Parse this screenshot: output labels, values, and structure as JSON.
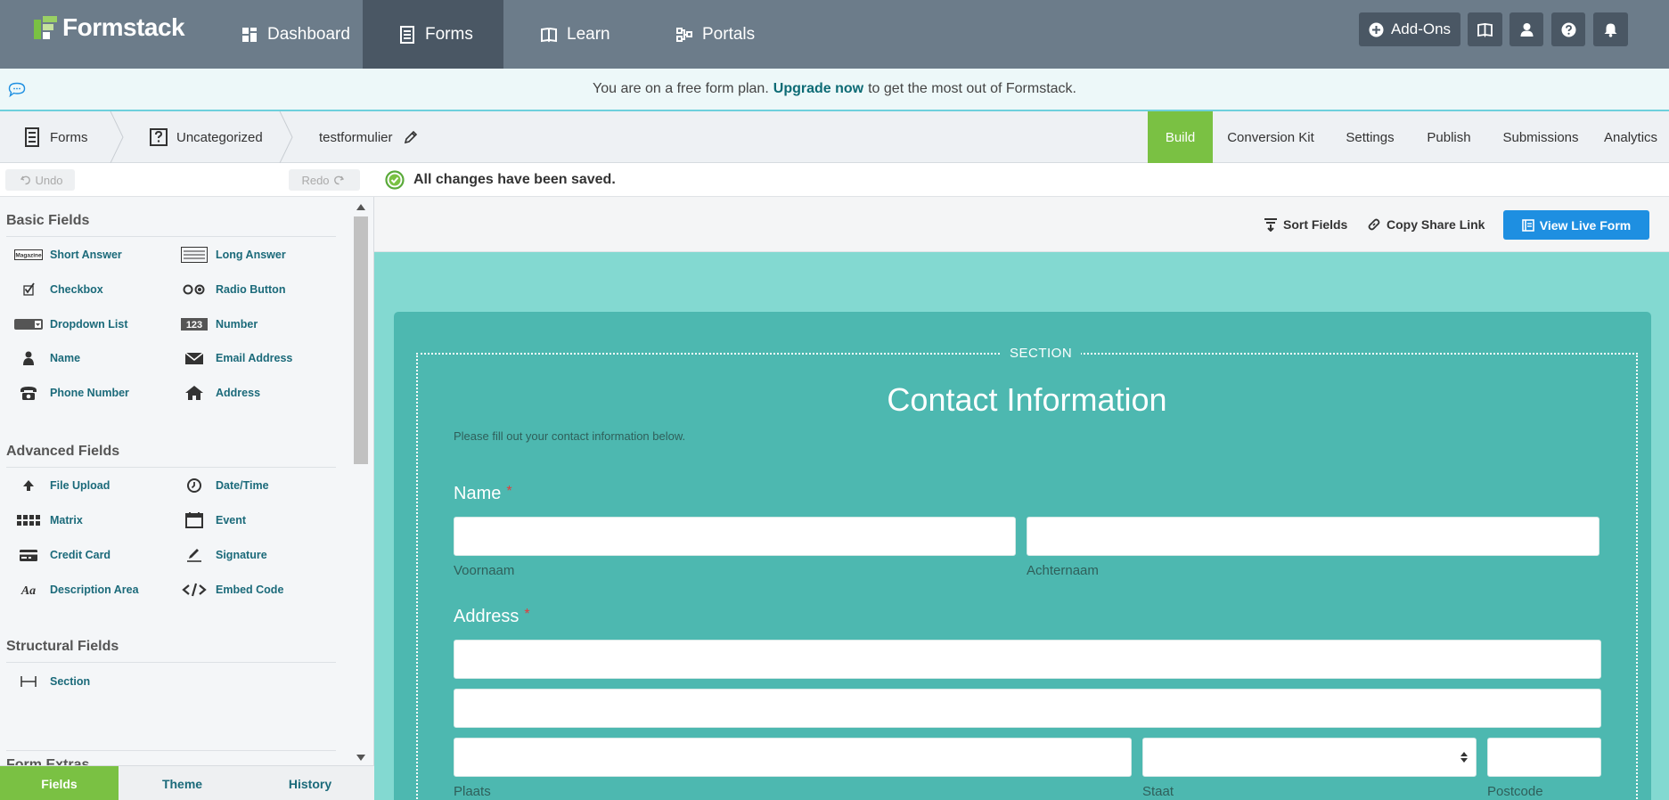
{
  "app": {
    "brand": "Formstack",
    "colors": {
      "nav_bg": "#6c7c8a",
      "nav_active": "#4a5764",
      "accent_green": "#7ac143",
      "primary_blue": "#1e8fe1",
      "form_bg": "#4db8b0",
      "canvas_bg": "#83d9d1"
    }
  },
  "topnav": {
    "items": [
      {
        "label": "Dashboard",
        "icon": "dashboard-icon"
      },
      {
        "label": "Forms",
        "icon": "forms-icon",
        "active": true
      },
      {
        "label": "Learn",
        "icon": "book-icon"
      },
      {
        "label": "Portals",
        "icon": "portals-icon"
      }
    ],
    "addons_label": "Add-Ons"
  },
  "notice": {
    "prefix": "You are on a free form plan.",
    "link": "Upgrade now",
    "suffix": "to get the most out of Formstack."
  },
  "breadcrumb": {
    "items": [
      "Forms",
      "Uncategorized",
      "testformulier"
    ]
  },
  "tabs": {
    "items": [
      "Build",
      "Conversion Kit",
      "Settings",
      "Publish",
      "Submissions",
      "Analytics"
    ],
    "active": "Build"
  },
  "history": {
    "undo": "Undo",
    "redo": "Redo"
  },
  "sidebar": {
    "sections": [
      {
        "title": "Basic Fields",
        "fields": [
          {
            "label": "Short Answer",
            "icon": "short-answer-icon"
          },
          {
            "label": "Long Answer",
            "icon": "long-answer-icon"
          },
          {
            "label": "Checkbox",
            "icon": "checkbox-icon"
          },
          {
            "label": "Radio Button",
            "icon": "radio-button-icon"
          },
          {
            "label": "Dropdown List",
            "icon": "dropdown-icon"
          },
          {
            "label": "Number",
            "icon": "number-icon"
          },
          {
            "label": "Name",
            "icon": "person-icon"
          },
          {
            "label": "Email Address",
            "icon": "envelope-icon"
          },
          {
            "label": "Phone Number",
            "icon": "phone-icon"
          },
          {
            "label": "Address",
            "icon": "home-icon"
          }
        ]
      },
      {
        "title": "Advanced Fields",
        "fields": [
          {
            "label": "File Upload",
            "icon": "upload-icon"
          },
          {
            "label": "Date/Time",
            "icon": "clock-icon"
          },
          {
            "label": "Matrix",
            "icon": "matrix-icon"
          },
          {
            "label": "Event",
            "icon": "calendar-icon"
          },
          {
            "label": "Credit Card",
            "icon": "credit-card-icon"
          },
          {
            "label": "Signature",
            "icon": "pen-icon"
          },
          {
            "label": "Description Area",
            "icon": "text-format-icon"
          },
          {
            "label": "Embed Code",
            "icon": "code-icon"
          }
        ]
      },
      {
        "title": "Structural Fields",
        "fields": [
          {
            "label": "Section",
            "icon": "section-icon"
          }
        ]
      },
      {
        "title": "Form Extras",
        "fields": []
      }
    ],
    "bottom_tabs": [
      "Fields",
      "Theme",
      "History"
    ]
  },
  "status": {
    "saved": "All changes have been saved."
  },
  "toolbar": {
    "sort": "Sort Fields",
    "copy": "Copy Share Link",
    "view_live": "View Live Form"
  },
  "form": {
    "section_label": "SECTION",
    "title": "Contact Information",
    "description": "Please fill out your contact information below.",
    "fields": {
      "name": {
        "label": "Name",
        "required_mark": "*",
        "sub_first": "Voornaam",
        "sub_last": "Achternaam"
      },
      "address": {
        "label": "Address",
        "required_mark": "*",
        "sub_city": "Plaats",
        "sub_state": "Staat",
        "sub_zip": "Postcode"
      }
    }
  }
}
